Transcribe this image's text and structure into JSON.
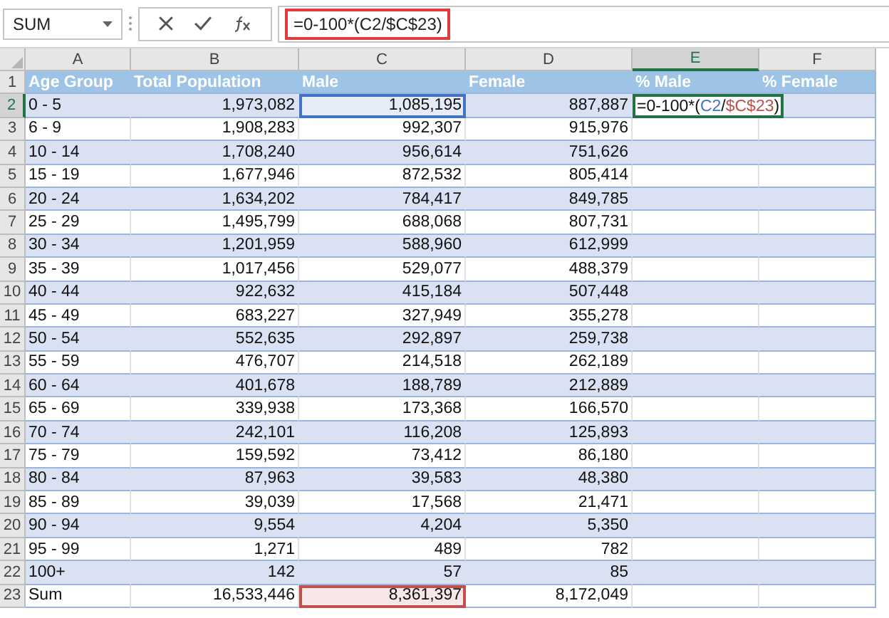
{
  "formula_bar": {
    "name_box": "SUM",
    "formula": "=0-100*(C2/$C$23)",
    "highlighted": true
  },
  "columns": [
    {
      "label": "A",
      "selected": false
    },
    {
      "label": "B",
      "selected": false
    },
    {
      "label": "C",
      "selected": false
    },
    {
      "label": "D",
      "selected": false
    },
    {
      "label": "E",
      "selected": true
    },
    {
      "label": "F",
      "selected": false
    }
  ],
  "rows": [
    {
      "number": "1",
      "selected": false,
      "kind": "header",
      "cells": [
        "Age Group",
        "Total Population",
        "Male",
        "Female",
        "% Male",
        "% Female"
      ]
    },
    {
      "number": "2",
      "selected": true,
      "kind": "data",
      "cells": [
        "0 - 5",
        "1,973,082",
        {
          "text": "1,085,195",
          "color": "#4472c4"
        },
        "887,887",
        {
          "kind": "formula",
          "parts": [
            {
              "text": "=0-100*("
            },
            {
              "text": "C2",
              "color": "#4472c4"
            },
            {
              "text": "/"
            },
            {
              "text": "$C$23",
              "color": "#c0504d"
            },
            {
              "text": ")"
            }
          ]
        },
        ""
      ]
    },
    {
      "number": "3",
      "selected": false,
      "kind": "data",
      "cells": [
        "6 - 9",
        "1,908,283",
        "992,307",
        "915,976",
        "",
        ""
      ]
    },
    {
      "number": "4",
      "selected": false,
      "kind": "data",
      "cells": [
        "10 - 14",
        "1,708,240",
        "956,614",
        "751,626",
        "",
        ""
      ]
    },
    {
      "number": "5",
      "selected": false,
      "kind": "data",
      "cells": [
        "15 - 19",
        "1,677,946",
        "872,532",
        "805,414",
        "",
        ""
      ]
    },
    {
      "number": "6",
      "selected": false,
      "kind": "data",
      "cells": [
        "20 - 24",
        "1,634,202",
        "784,417",
        "849,785",
        "",
        ""
      ]
    },
    {
      "number": "7",
      "selected": false,
      "kind": "data",
      "cells": [
        "25 - 29",
        "1,495,799",
        "688,068",
        "807,731",
        "",
        ""
      ]
    },
    {
      "number": "8",
      "selected": false,
      "kind": "data",
      "cells": [
        "30 - 34",
        "1,201,959",
        "588,960",
        "612,999",
        "",
        ""
      ]
    },
    {
      "number": "9",
      "selected": false,
      "kind": "data",
      "cells": [
        "35 - 39",
        "1,017,456",
        "529,077",
        "488,379",
        "",
        ""
      ]
    },
    {
      "number": "10",
      "selected": false,
      "kind": "data",
      "cells": [
        "40 - 44",
        "922,632",
        "415,184",
        "507,448",
        "",
        ""
      ]
    },
    {
      "number": "11",
      "selected": false,
      "kind": "data",
      "cells": [
        "45 - 49",
        "683,227",
        "327,949",
        "355,278",
        "",
        ""
      ]
    },
    {
      "number": "12",
      "selected": false,
      "kind": "data",
      "cells": [
        "50 - 54",
        "552,635",
        "292,897",
        "259,738",
        "",
        ""
      ]
    },
    {
      "number": "13",
      "selected": false,
      "kind": "data",
      "cells": [
        "55 - 59",
        "476,707",
        "214,518",
        "262,189",
        "",
        ""
      ]
    },
    {
      "number": "14",
      "selected": false,
      "kind": "data",
      "cells": [
        "60 - 64",
        "401,678",
        "188,789",
        "212,889",
        "",
        ""
      ]
    },
    {
      "number": "15",
      "selected": false,
      "kind": "data",
      "cells": [
        "65 - 69",
        "339,938",
        "173,368",
        "166,570",
        "",
        ""
      ]
    },
    {
      "number": "16",
      "selected": false,
      "kind": "data",
      "cells": [
        "70 - 74",
        "242,101",
        "116,208",
        "125,893",
        "",
        ""
      ]
    },
    {
      "number": "17",
      "selected": false,
      "kind": "data",
      "cells": [
        "75 - 79",
        "159,592",
        "73,412",
        "86,180",
        "",
        ""
      ]
    },
    {
      "number": "18",
      "selected": false,
      "kind": "data",
      "cells": [
        "80 - 84",
        "87,963",
        "39,583",
        "48,380",
        "",
        ""
      ]
    },
    {
      "number": "19",
      "selected": false,
      "kind": "data",
      "cells": [
        "85 - 89",
        "39,039",
        "17,568",
        "21,471",
        "",
        ""
      ]
    },
    {
      "number": "20",
      "selected": false,
      "kind": "data",
      "cells": [
        "90 - 94",
        "9,554",
        "4,204",
        "5,350",
        "",
        ""
      ]
    },
    {
      "number": "21",
      "selected": false,
      "kind": "data",
      "cells": [
        "95 - 99",
        "1,271",
        "489",
        "782",
        "",
        ""
      ]
    },
    {
      "number": "22",
      "selected": false,
      "kind": "data",
      "cells": [
        "100+",
        "142",
        "57",
        "85",
        "",
        ""
      ]
    },
    {
      "number": "23",
      "selected": false,
      "kind": "data",
      "cells": [
        "Sum",
        "16,533,446",
        {
          "text": "8,361,397",
          "color": "#c0504d"
        },
        "8,172,049",
        "",
        ""
      ]
    }
  ]
}
